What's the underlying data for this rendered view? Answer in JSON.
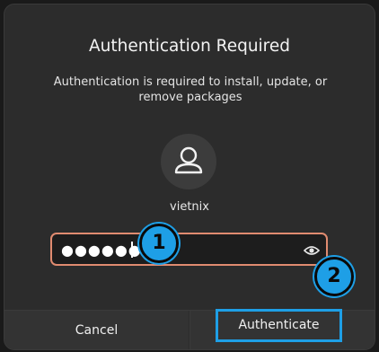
{
  "dialog": {
    "title": "Authentication Required",
    "message": "Authentication is required to install, update, or remove packages",
    "username": "vietnix",
    "avatar_icon": "user-icon"
  },
  "password": {
    "masked_value": "●●●●●●",
    "reveal_icon": "eye-icon",
    "border_color": "#e08b70"
  },
  "buttons": {
    "cancel_label": "Cancel",
    "authenticate_label": "Authenticate"
  },
  "annotations": {
    "badge_1": "1",
    "badge_2": "2",
    "highlight_color": "#1e9fe6"
  }
}
